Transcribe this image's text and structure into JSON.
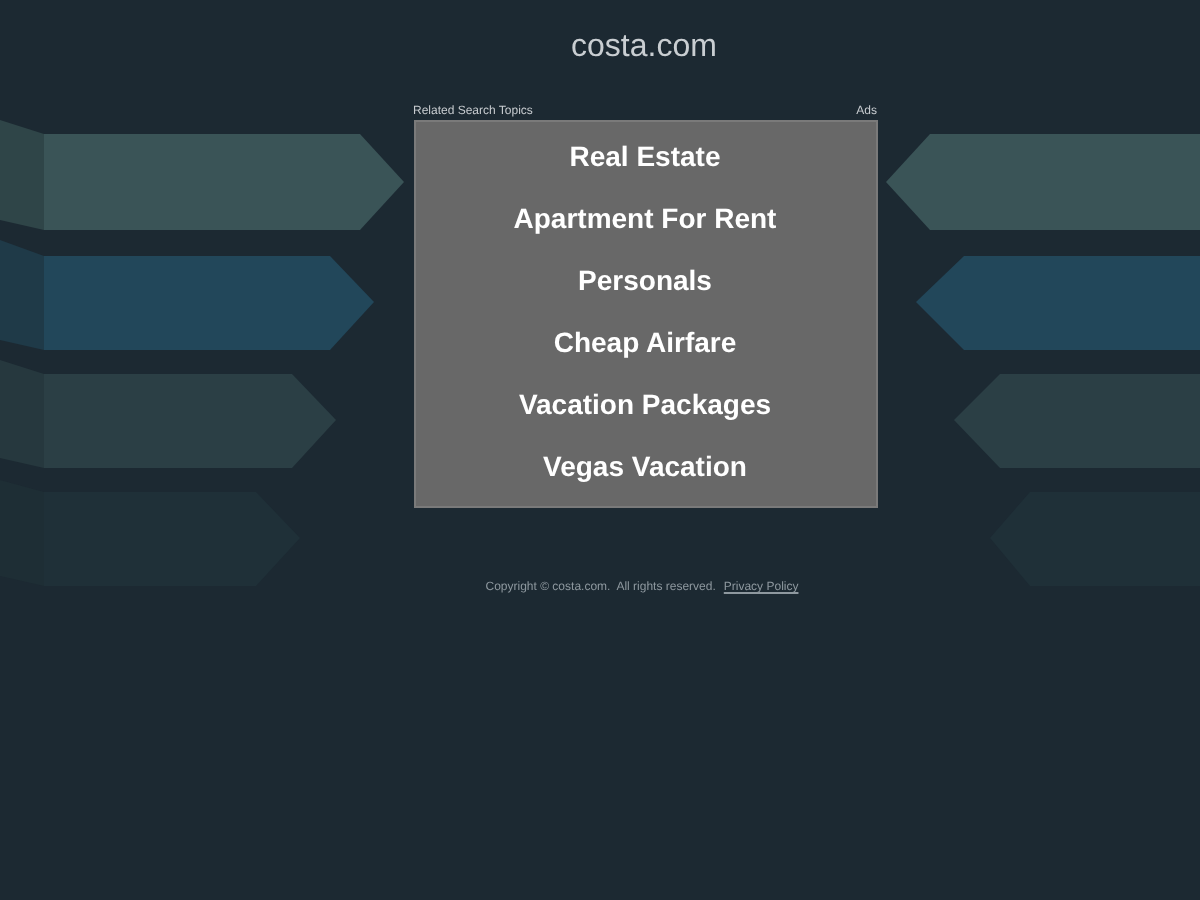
{
  "site_title": "costa.com",
  "panel": {
    "heading": "Related Search Topics",
    "ads_label": "Ads",
    "links": [
      "Real Estate",
      "Apartment For Rent",
      "Personals",
      "Cheap Airfare",
      "Vacation Packages",
      "Vegas Vacation"
    ]
  },
  "footer": {
    "copyright": "Copyright © costa.com.  All rights reserved.",
    "privacy_link": "Privacy Policy"
  }
}
